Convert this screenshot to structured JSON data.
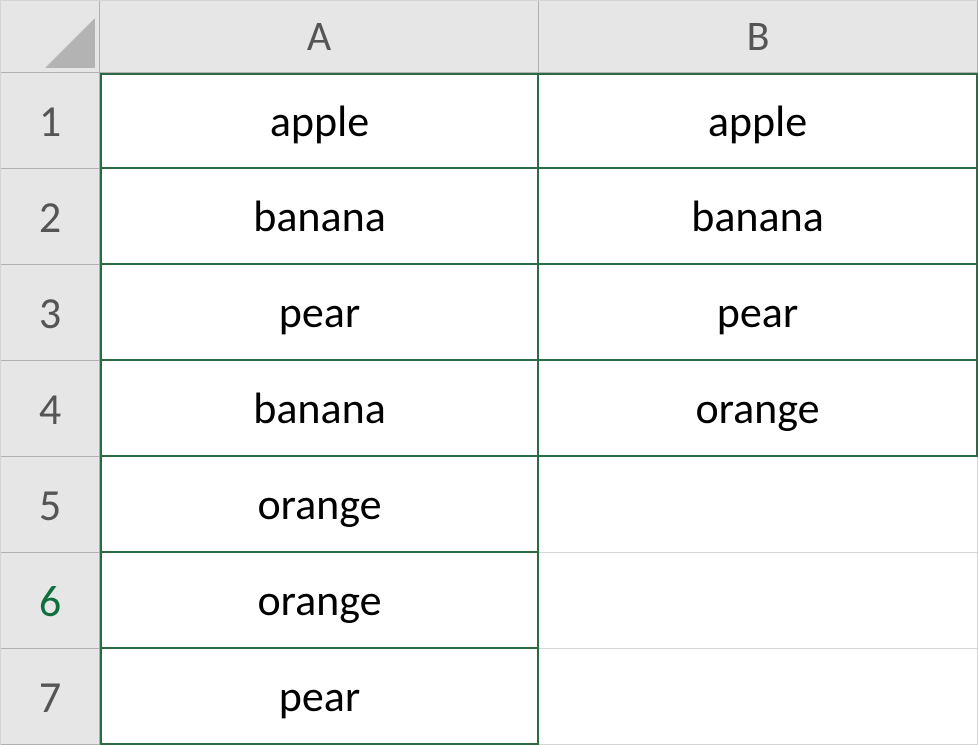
{
  "columns": {
    "A": "A",
    "B": "B"
  },
  "rows": {
    "r1": "1",
    "r2": "2",
    "r3": "3",
    "r4": "4",
    "r5": "5",
    "r6": "6",
    "r7": "7"
  },
  "cells": {
    "A1": "apple",
    "A2": "banana",
    "A3": "pear",
    "A4": "banana",
    "A5": "orange",
    "A6": "orange",
    "A7": "pear",
    "B1": "apple",
    "B2": "banana",
    "B3": "pear",
    "B4": "orange",
    "B5": "",
    "B6": "",
    "B7": ""
  }
}
